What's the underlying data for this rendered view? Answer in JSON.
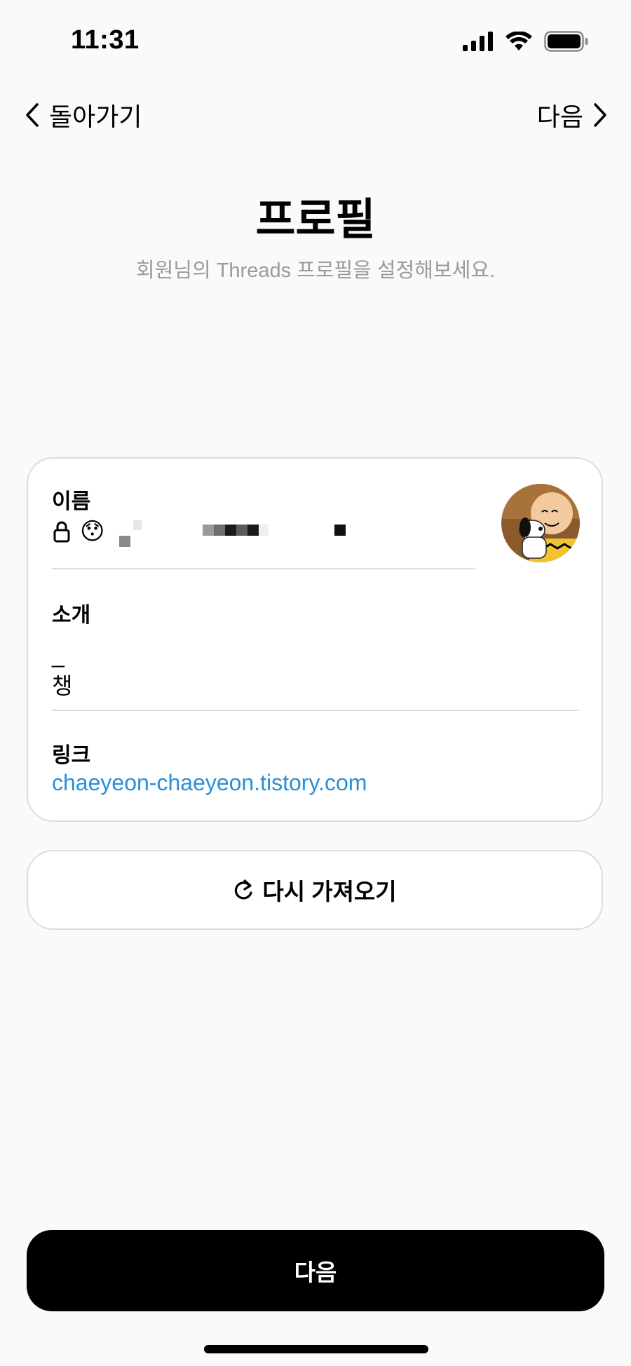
{
  "status_bar": {
    "time": "11:31"
  },
  "nav": {
    "back_label": "돌아가기",
    "next_label": "다음"
  },
  "header": {
    "title": "프로필",
    "subtitle": "회원님의 Threads 프로필을 설정해보세요."
  },
  "profile_card": {
    "name": {
      "label": "이름",
      "emoji": "😯"
    },
    "bio": {
      "label": "소개",
      "value": "_\n챙"
    },
    "link": {
      "label": "링크",
      "value": "chaeyeon-chaeyeon.tistory.com"
    }
  },
  "reimport_button": {
    "label": "다시 가져오기"
  },
  "primary_button": {
    "label": "다음"
  },
  "colors": {
    "background": "#fafafa",
    "link": "#2b8fd6",
    "primary_button": "#000000",
    "subtitle": "#9a9a9a"
  }
}
